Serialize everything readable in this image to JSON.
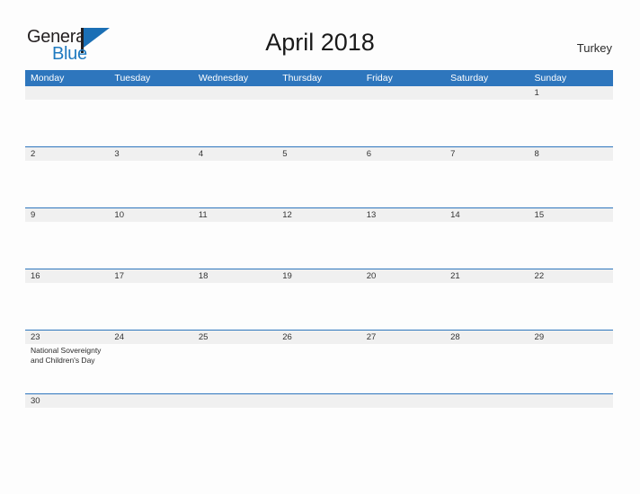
{
  "brand": {
    "name_part1": "General",
    "name_part2": "Blue",
    "flag_icon": "flag-icon"
  },
  "header": {
    "title": "April 2018",
    "country": "Turkey"
  },
  "calendar": {
    "weekday_headers": [
      "Monday",
      "Tuesday",
      "Wednesday",
      "Thursday",
      "Friday",
      "Saturday",
      "Sunday"
    ],
    "colors": {
      "header_blue": "#2e76bd",
      "number_band_gray": "#f0f0f0",
      "cell_background": "#fdfdfd",
      "page_background": "#fdfdfd",
      "logo_blue": "#1f7ac0",
      "text_dark": "#231f20"
    },
    "weeks": [
      {
        "days": [
          {
            "num": "",
            "event": ""
          },
          {
            "num": "",
            "event": ""
          },
          {
            "num": "",
            "event": ""
          },
          {
            "num": "",
            "event": ""
          },
          {
            "num": "",
            "event": ""
          },
          {
            "num": "",
            "event": ""
          },
          {
            "num": "1",
            "event": ""
          }
        ]
      },
      {
        "days": [
          {
            "num": "2",
            "event": ""
          },
          {
            "num": "3",
            "event": ""
          },
          {
            "num": "4",
            "event": ""
          },
          {
            "num": "5",
            "event": ""
          },
          {
            "num": "6",
            "event": ""
          },
          {
            "num": "7",
            "event": ""
          },
          {
            "num": "8",
            "event": ""
          }
        ]
      },
      {
        "days": [
          {
            "num": "9",
            "event": ""
          },
          {
            "num": "10",
            "event": ""
          },
          {
            "num": "11",
            "event": ""
          },
          {
            "num": "12",
            "event": ""
          },
          {
            "num": "13",
            "event": ""
          },
          {
            "num": "14",
            "event": ""
          },
          {
            "num": "15",
            "event": ""
          }
        ]
      },
      {
        "days": [
          {
            "num": "16",
            "event": ""
          },
          {
            "num": "17",
            "event": ""
          },
          {
            "num": "18",
            "event": ""
          },
          {
            "num": "19",
            "event": ""
          },
          {
            "num": "20",
            "event": ""
          },
          {
            "num": "21",
            "event": ""
          },
          {
            "num": "22",
            "event": ""
          }
        ]
      },
      {
        "days": [
          {
            "num": "23",
            "event": "National Sovereignty and Children's Day"
          },
          {
            "num": "24",
            "event": ""
          },
          {
            "num": "25",
            "event": ""
          },
          {
            "num": "26",
            "event": ""
          },
          {
            "num": "27",
            "event": ""
          },
          {
            "num": "28",
            "event": ""
          },
          {
            "num": "29",
            "event": ""
          }
        ]
      },
      {
        "days": [
          {
            "num": "30",
            "event": ""
          },
          {
            "num": "",
            "event": ""
          },
          {
            "num": "",
            "event": ""
          },
          {
            "num": "",
            "event": ""
          },
          {
            "num": "",
            "event": ""
          },
          {
            "num": "",
            "event": ""
          },
          {
            "num": "",
            "event": ""
          }
        ]
      }
    ]
  }
}
